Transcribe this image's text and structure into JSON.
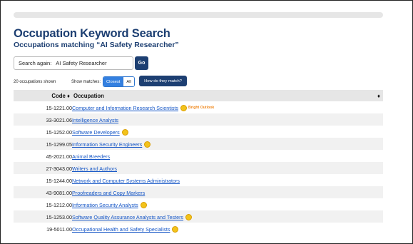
{
  "page": {
    "title": "Occupation Keyword Search",
    "subtitle": "Occupations matching “AI Safety Researcher”"
  },
  "search": {
    "label": "Search again:",
    "value": "AI Safety Researcher",
    "go_label": "Go"
  },
  "controls": {
    "count_text": "20 occupations shown",
    "show_matches_label": "Show matches:",
    "closest_label": "Closest",
    "all_label": "All",
    "how_button_label": "How do they match?"
  },
  "table": {
    "headers": {
      "code": "Code ♦",
      "occupation": "Occupation",
      "sort_icon": "♦"
    },
    "rows": [
      {
        "code": "15-1221.00",
        "occupation": "Computer and Information Research Scientists",
        "bright": true,
        "bright_label": "Bright Outlook"
      },
      {
        "code": "33-3021.06",
        "occupation": "Intelligence Analysts",
        "bright": false
      },
      {
        "code": "15-1252.00",
        "occupation": "Software Developers",
        "bright": true
      },
      {
        "code": "15-1299.05",
        "occupation": "Information Security Engineers",
        "bright": true
      },
      {
        "code": "45-2021.00",
        "occupation": "Animal Breeders",
        "bright": false
      },
      {
        "code": "27-3043.00",
        "occupation": "Writers and Authors",
        "bright": false
      },
      {
        "code": "15-1244.00",
        "occupation": "Network and Computer Systems Administrators",
        "bright": false
      },
      {
        "code": "43-9081.00",
        "occupation": "Proofreaders and Copy Markers",
        "bright": false
      },
      {
        "code": "15-1212.00",
        "occupation": "Information Security Analysts",
        "bright": true
      },
      {
        "code": "15-1253.00",
        "occupation": "Software Quality Assurance Analysts and Testers",
        "bright": true
      },
      {
        "code": "19-5011.00",
        "occupation": "Occupational Health and Safety Specialists",
        "bright": true
      }
    ]
  },
  "colors": {
    "brand": "#1d3f72",
    "link": "#1556c6",
    "bright_outlook": "#f3c31b",
    "toggle_active": "#3480e0"
  }
}
